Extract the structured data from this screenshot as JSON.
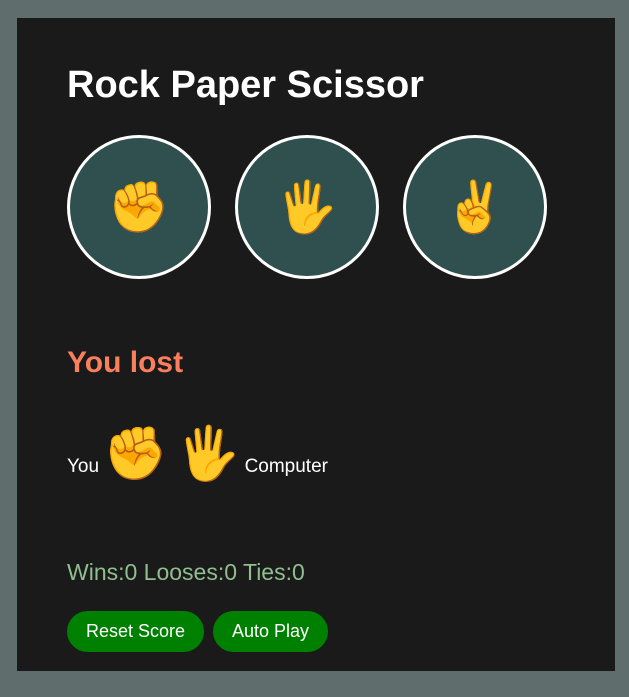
{
  "title": "Rock Paper Scissor",
  "choices": [
    {
      "name": "rock",
      "emoji": "✊"
    },
    {
      "name": "paper",
      "emoji": "🖐"
    },
    {
      "name": "scissors",
      "emoji": "✌️"
    }
  ],
  "result": {
    "text": "You lost",
    "color": "#fa7f5c"
  },
  "moves": {
    "you_label": "You",
    "you_emoji": "✊",
    "computer_emoji": "🖐",
    "computer_label": "Computer"
  },
  "score": {
    "text": "Wins:0 Looses:0 Ties:0"
  },
  "buttons": {
    "reset_label": "Reset Score",
    "auto_label": "Auto Play"
  },
  "colors": {
    "page_background": "#5f6e6c",
    "panel_background": "#1a1a1a",
    "choice_background": "#2f504f",
    "button_background": "#008000",
    "score_text": "#8fbf8f"
  }
}
